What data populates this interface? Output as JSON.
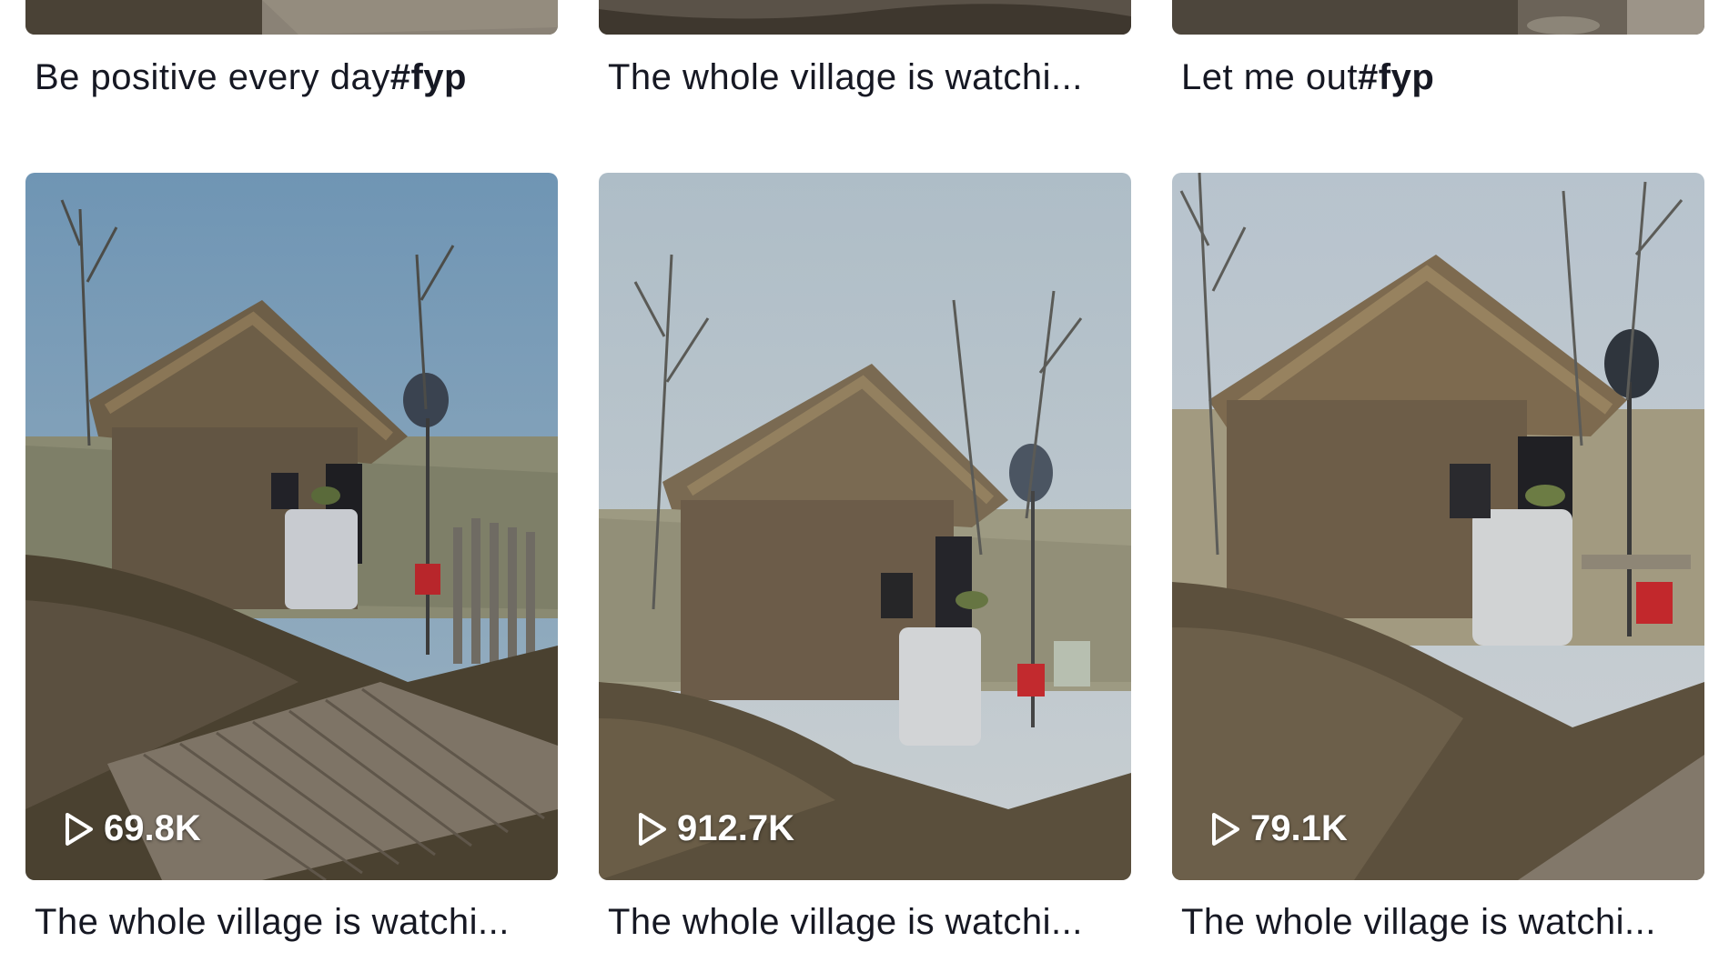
{
  "top_row": [
    {
      "caption_text": "Be positive every day",
      "caption_tag": "#fyp"
    },
    {
      "caption_text": "The whole village is watchi...",
      "caption_tag": ""
    },
    {
      "caption_text": "Let me out",
      "caption_tag": "#fyp"
    }
  ],
  "bottom_row": [
    {
      "views": "69.8K",
      "caption_text": "The whole village is watchi...",
      "caption_tag": ""
    },
    {
      "views": "912.7K",
      "caption_text": "The whole village is watchi...",
      "caption_tag": ""
    },
    {
      "views": "79.1K",
      "caption_text": "The whole village is watchi...",
      "caption_tag": ""
    }
  ],
  "icons": {
    "views": "play-icon"
  },
  "colors": {
    "caption_text": "#161823",
    "views_text": "#ffffff",
    "background": "#ffffff"
  }
}
